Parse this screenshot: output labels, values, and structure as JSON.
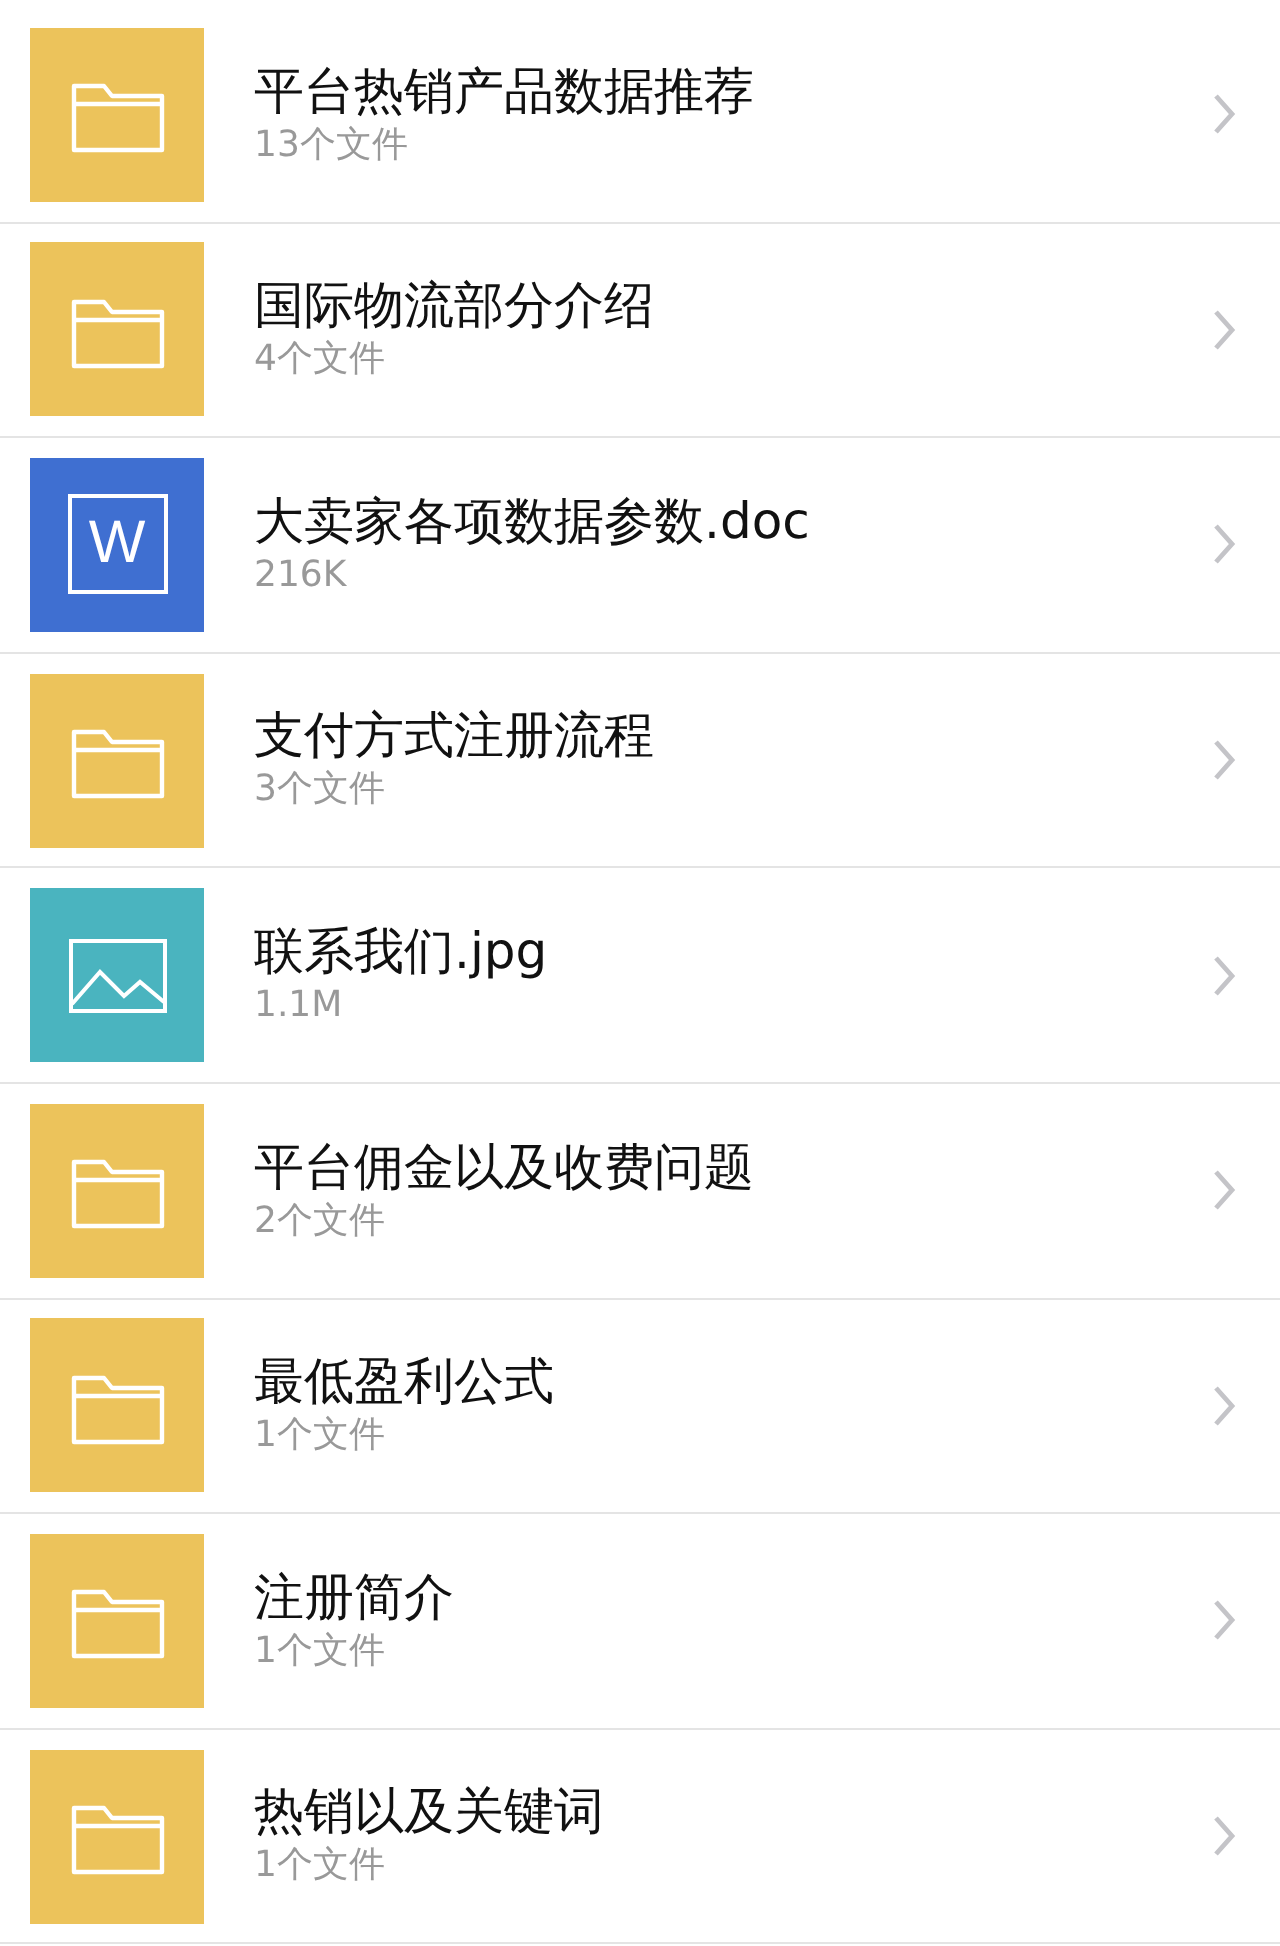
{
  "files": [
    {
      "kind": "folder",
      "title": "平台热销产品数据推荐",
      "subtitle": "13个文件"
    },
    {
      "kind": "folder",
      "title": "国际物流部分介绍",
      "subtitle": "4个文件"
    },
    {
      "kind": "word",
      "title": "大卖家各项数据参数.doc",
      "subtitle": "216K",
      "icon_text": "W"
    },
    {
      "kind": "folder",
      "title": "支付方式注册流程",
      "subtitle": "3个文件"
    },
    {
      "kind": "image",
      "title": "联系我们.jpg",
      "subtitle": "1.1M"
    },
    {
      "kind": "folder",
      "title": "平台佣金以及收费问题",
      "subtitle": "2个文件"
    },
    {
      "kind": "folder",
      "title": "最低盈利公式",
      "subtitle": "1个文件"
    },
    {
      "kind": "folder",
      "title": "注册简介",
      "subtitle": "1个文件"
    },
    {
      "kind": "folder",
      "title": "热销以及关键词",
      "subtitle": "1个文件"
    }
  ]
}
